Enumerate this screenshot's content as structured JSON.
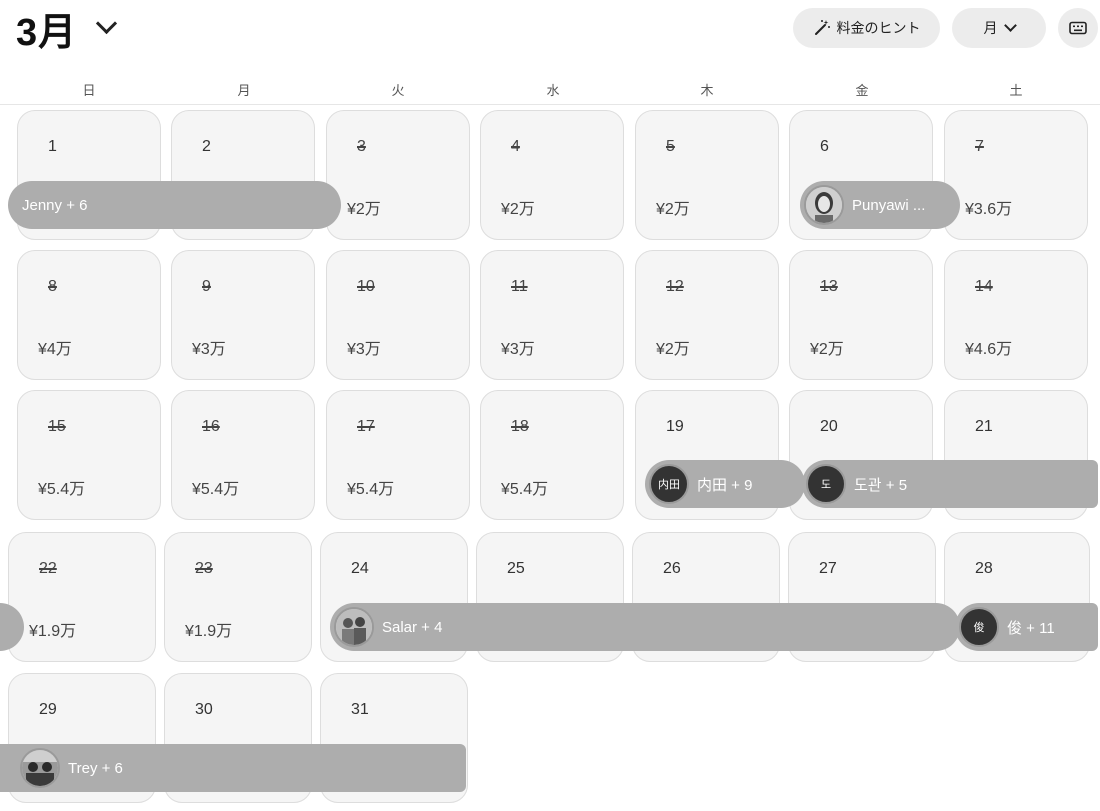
{
  "header": {
    "month": "3月",
    "hint_button": "料金のヒント",
    "view_button": "月",
    "keyboard_icon": "keyboard-icon"
  },
  "weekdays": [
    "日",
    "月",
    "火",
    "水",
    "木",
    "金",
    "土"
  ],
  "calendar": {
    "week1": [
      {
        "day": "1",
        "price": ""
      },
      {
        "day": "2",
        "price": ""
      },
      {
        "day": "3",
        "price": "¥2万"
      },
      {
        "day": "4",
        "price": "¥2万"
      },
      {
        "day": "5",
        "price": "¥2万"
      },
      {
        "day": "6",
        "price": ""
      },
      {
        "day": "7",
        "price": "¥3.6万"
      }
    ],
    "week2": [
      {
        "day": "8",
        "price": "¥4万"
      },
      {
        "day": "9",
        "price": "¥3万"
      },
      {
        "day": "10",
        "price": "¥3万"
      },
      {
        "day": "11",
        "price": "¥3万"
      },
      {
        "day": "12",
        "price": "¥2万"
      },
      {
        "day": "13",
        "price": "¥2万"
      },
      {
        "day": "14",
        "price": "¥4.6万"
      }
    ],
    "week3": [
      {
        "day": "15",
        "price": "¥5.4万"
      },
      {
        "day": "16",
        "price": "¥5.4万"
      },
      {
        "day": "17",
        "price": "¥5.4万"
      },
      {
        "day": "18",
        "price": "¥5.4万"
      },
      {
        "day": "19",
        "price": ""
      },
      {
        "day": "20",
        "price": ""
      },
      {
        "day": "21",
        "price": ""
      }
    ],
    "week4": [
      {
        "day": "22",
        "price": "¥1.9万"
      },
      {
        "day": "23",
        "price": "¥1.9万"
      },
      {
        "day": "24",
        "price": ""
      },
      {
        "day": "25",
        "price": ""
      },
      {
        "day": "26",
        "price": ""
      },
      {
        "day": "27",
        "price": ""
      },
      {
        "day": "28",
        "price": ""
      }
    ],
    "week5": [
      {
        "day": "29",
        "price": ""
      },
      {
        "day": "30",
        "price": ""
      },
      {
        "day": "31",
        "price": ""
      }
    ]
  },
  "reservations": [
    {
      "label": "Jenny + 6"
    },
    {
      "label": "Punyawi ..."
    },
    {
      "label": "内田 + 9",
      "initials": "内田"
    },
    {
      "label": "도관 + 5",
      "initials": "도"
    },
    {
      "label": "Salar + 4"
    },
    {
      "label": "俊 + 11",
      "initials": "俊"
    },
    {
      "label": "Trey + 6"
    }
  ]
}
